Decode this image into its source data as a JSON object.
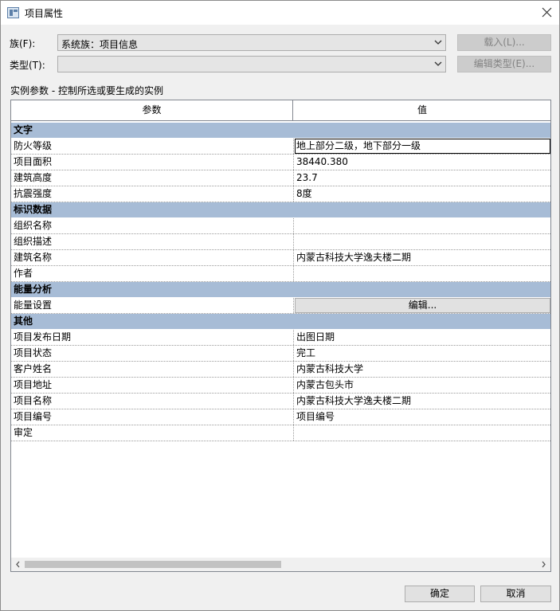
{
  "window": {
    "title": "项目属性"
  },
  "family": {
    "label": "族(F):",
    "value": "系统族：项目信息",
    "load_button": "载入(L)..."
  },
  "type": {
    "label": "类型(T):",
    "value": "",
    "edit_type_button": "编辑类型(E)..."
  },
  "caption": "实例参数 - 控制所选或要生成的实例",
  "grid": {
    "header": {
      "param": "参数",
      "value": "值"
    },
    "groups": [
      {
        "name": "文字",
        "rows": [
          {
            "param": "防火等级",
            "value": "地上部分二级，地下部分一级"
          },
          {
            "param": "项目面积",
            "value": "38440.380"
          },
          {
            "param": "建筑高度",
            "value": "23.7"
          },
          {
            "param": "抗震强度",
            "value": "8度"
          }
        ]
      },
      {
        "name": "标识数据",
        "rows": [
          {
            "param": "组织名称",
            "value": ""
          },
          {
            "param": "组织描述",
            "value": ""
          },
          {
            "param": "建筑名称",
            "value": "内蒙古科技大学逸夫楼二期"
          },
          {
            "param": "作者",
            "value": ""
          }
        ]
      },
      {
        "name": "能量分析",
        "rows": [
          {
            "param": "能量设置",
            "button": "编辑..."
          }
        ]
      },
      {
        "name": "其他",
        "rows": [
          {
            "param": "项目发布日期",
            "value": "出图日期"
          },
          {
            "param": "项目状态",
            "value": "完工"
          },
          {
            "param": "客户姓名",
            "value": "内蒙古科技大学"
          },
          {
            "param": "项目地址",
            "value": "内蒙古包头市"
          },
          {
            "param": "项目名称",
            "value": "内蒙古科技大学逸夫楼二期"
          },
          {
            "param": "项目编号",
            "value": "项目编号"
          },
          {
            "param": "审定",
            "value": ""
          }
        ]
      }
    ]
  },
  "footer": {
    "ok": "确定",
    "cancel": "取消"
  },
  "icons": {
    "close": "close-icon",
    "dropdown": "chevron-down-icon",
    "scroll_left": "chevron-left-icon",
    "scroll_right": "chevron-right-icon"
  }
}
